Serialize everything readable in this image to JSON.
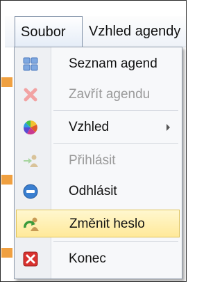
{
  "menubar": {
    "items": [
      {
        "label": "Soubor"
      },
      {
        "label": "Vzhled agendy"
      }
    ]
  },
  "menu": {
    "items": [
      {
        "label": "Seznam agend",
        "icon": "grid-icon",
        "enabled": true
      },
      {
        "label": "Zavřít agendu",
        "icon": "close-icon",
        "enabled": false
      },
      {
        "label": "Vzhled",
        "icon": "color-wheel-icon",
        "enabled": true,
        "submenu": true
      },
      {
        "label": "Přihlásit",
        "icon": "login-icon",
        "enabled": false
      },
      {
        "label": "Odhlásit",
        "icon": "logout-icon",
        "enabled": true
      },
      {
        "label": "Změnit heslo",
        "icon": "change-password-icon",
        "enabled": true,
        "highlighted": true
      },
      {
        "label": "Konec",
        "icon": "exit-icon",
        "enabled": true
      }
    ]
  },
  "colors": {
    "highlight": "#ffe99a",
    "exit_red": "#d9322f",
    "logout_blue": "#3a7fd0"
  }
}
